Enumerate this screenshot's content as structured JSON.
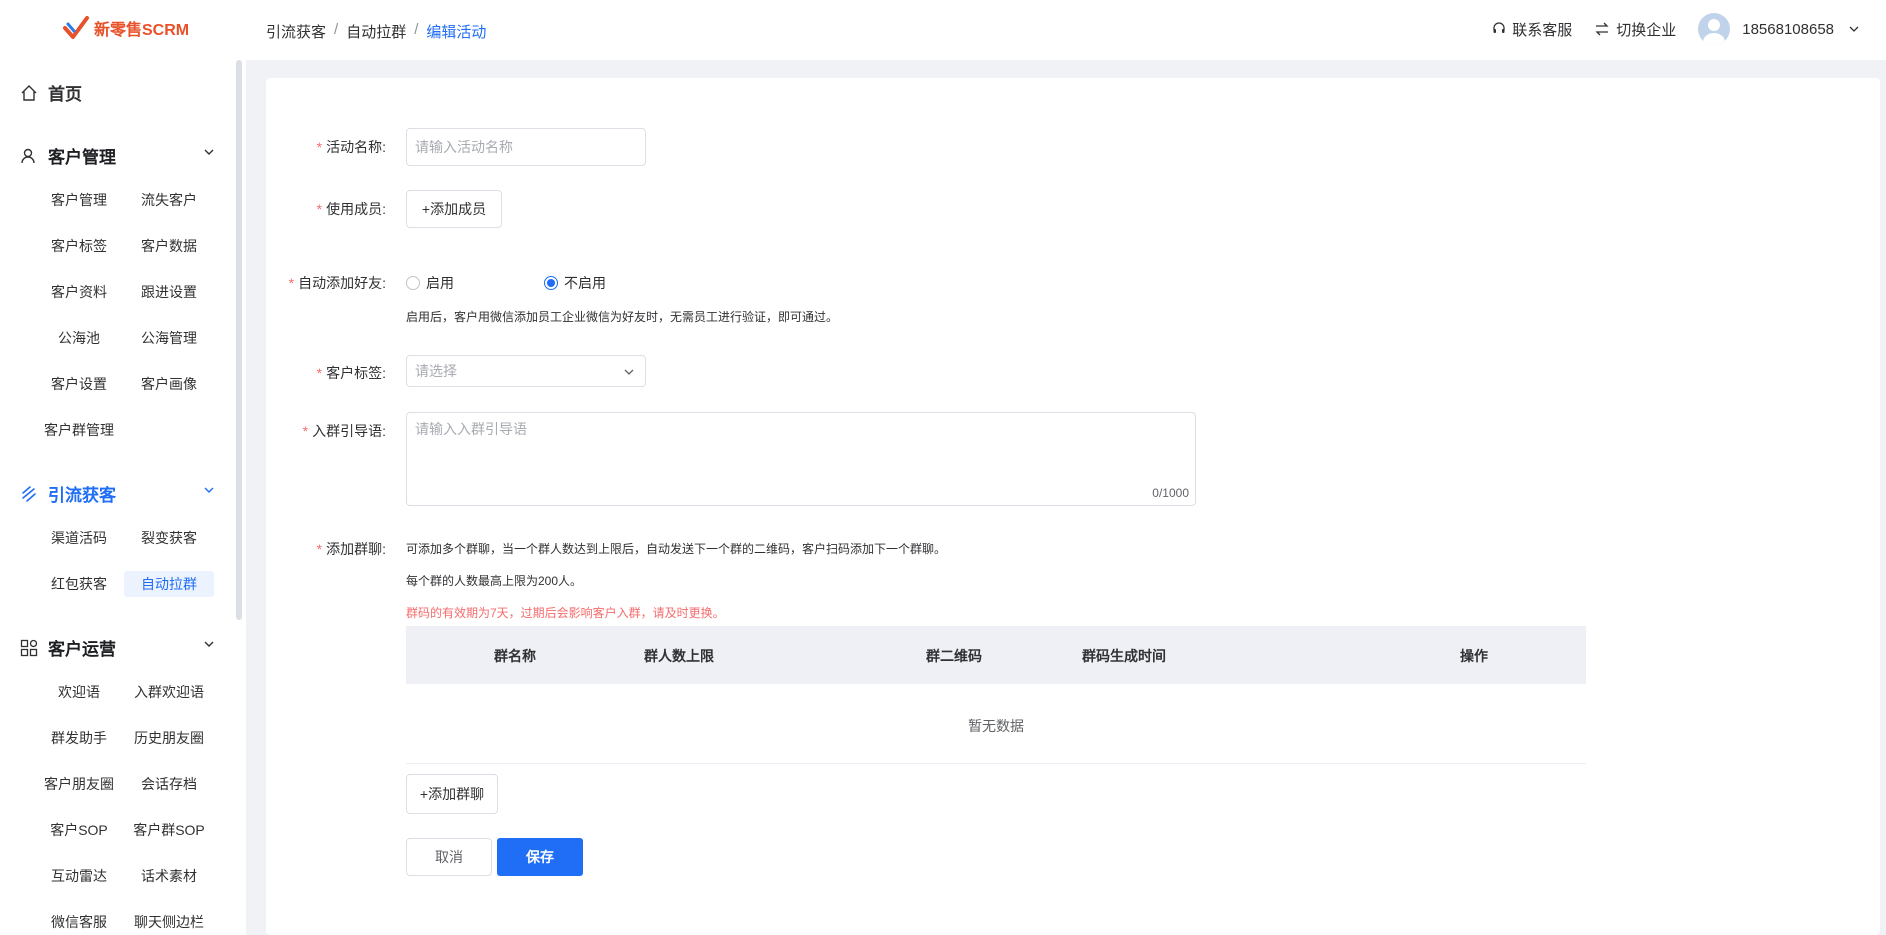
{
  "header": {
    "logo_text": "新零售SCRM",
    "breadcrumb": [
      "引流获客",
      "自动拉群",
      "编辑活动"
    ],
    "service_label": "联系客服",
    "switch_label": "切换企业",
    "user_phone": "18568108658"
  },
  "sidebar": {
    "home": "首页",
    "groups": [
      {
        "title": "客户管理",
        "items": [
          "客户管理",
          "流失客户",
          "客户标签",
          "客户数据",
          "客户资料",
          "跟进设置",
          "公海池",
          "公海管理",
          "客户设置",
          "客户画像",
          "客户群管理"
        ]
      },
      {
        "title": "引流获客",
        "items": [
          "渠道活码",
          "裂变获客",
          "红包获客",
          "自动拉群"
        ]
      },
      {
        "title": "客户运营",
        "items": [
          "欢迎语",
          "入群欢迎语",
          "群发助手",
          "历史朋友圈",
          "客户朋友圈",
          "会话存档",
          "客户SOP",
          "客户群SOP",
          "互动雷达",
          "话术素材",
          "微信客服",
          "聊天侧边栏"
        ]
      }
    ]
  },
  "form": {
    "name_label": "活动名称:",
    "name_placeholder": "请输入活动名称",
    "member_label": "使用成员:",
    "member_button": "+添加成员",
    "auto_label": "自动添加好友:",
    "auto_on": "启用",
    "auto_off": "不启用",
    "auto_hint": "启用后，客户用微信添加员工企业微信为好友时，无需员工进行验证，即可通过。",
    "tag_label": "客户标签:",
    "tag_placeholder": "请选择",
    "guide_label": "入群引导语:",
    "guide_placeholder": "请输入入群引导语",
    "guide_count": "0/1000",
    "group_label": "添加群聊:",
    "group_hint1": "可添加多个群聊，当一个群人数达到上限后，自动发送下一个群的二维码，客户扫码添加下一个群聊。",
    "group_hint2": "每个群的人数最高上限为200人。",
    "group_hint3": "群码的有效期为7天，过期后会影响客户入群，请及时更换。",
    "table_headers": [
      "群名称",
      "群人数上限",
      "群二维码",
      "群码生成时间",
      "操作"
    ],
    "empty_text": "暂无数据",
    "add_group_button": "+添加群聊",
    "cancel_button": "取消",
    "save_button": "保存"
  }
}
